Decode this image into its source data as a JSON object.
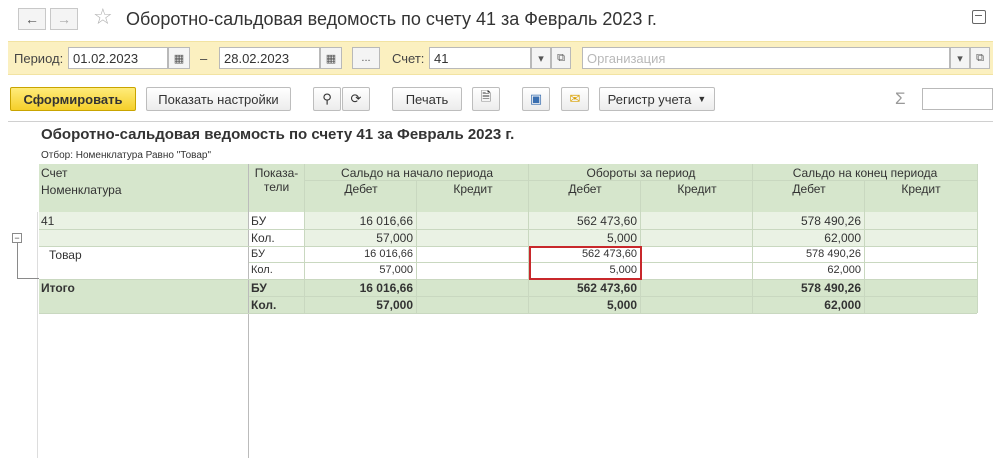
{
  "window": {
    "title": "Оборотно-сальдовая ведомость по счету 41 за Февраль 2023 г.",
    "back_icon": "arrow-left-icon",
    "forward_icon": "arrow-right-icon"
  },
  "filters": {
    "period_label": "Период:",
    "date_from": "01.02.2023",
    "dash": "–",
    "date_to": "28.02.2023",
    "period_select": "...",
    "account_label": "Счет:",
    "account_value": "41",
    "organization_placeholder": "Организация"
  },
  "toolbar": {
    "generate_label": "Сформировать",
    "settings_label": "Показать настройки",
    "print_label": "Печать",
    "register_label": "Регистр учета",
    "sum_symbol": "Σ"
  },
  "report": {
    "title": "Оборотно-сальдовая ведомость по счету 41 за Февраль 2023 г.",
    "filter_text": "Отбор: Номенклатура Равно \"Товар\"",
    "headers": {
      "account": "Счет",
      "nomenclature": "Номенклатура",
      "indicators_1": "Показа-",
      "indicators_2": "тели",
      "opening": "Сальдо на начало периода",
      "turnover": "Обороты за период",
      "closing": "Сальдо на конец периода",
      "debit": "Дебет",
      "credit": "Кредит"
    },
    "rows": [
      {
        "name": "41",
        "ind": "БУ",
        "open_d": "16 016,66",
        "turn_d": "562 473,60",
        "close_d": "578 490,26"
      },
      {
        "name": "",
        "ind": "Кол.",
        "open_d": "57,000",
        "turn_d": "5,000",
        "close_d": "62,000"
      },
      {
        "name": "Товар",
        "ind": "БУ",
        "open_d": "16 016,66",
        "turn_d": "562 473,60",
        "close_d": "578 490,26"
      },
      {
        "name": "",
        "ind": "Кол.",
        "open_d": "57,000",
        "turn_d": "5,000",
        "close_d": "62,000"
      },
      {
        "name": "Итого",
        "ind": "БУ",
        "open_d": "16 016,66",
        "turn_d": "562 473,60",
        "close_d": "578 490,26"
      },
      {
        "name": "",
        "ind": "Кол.",
        "open_d": "57,000",
        "turn_d": "5,000",
        "close_d": "62,000"
      }
    ]
  }
}
